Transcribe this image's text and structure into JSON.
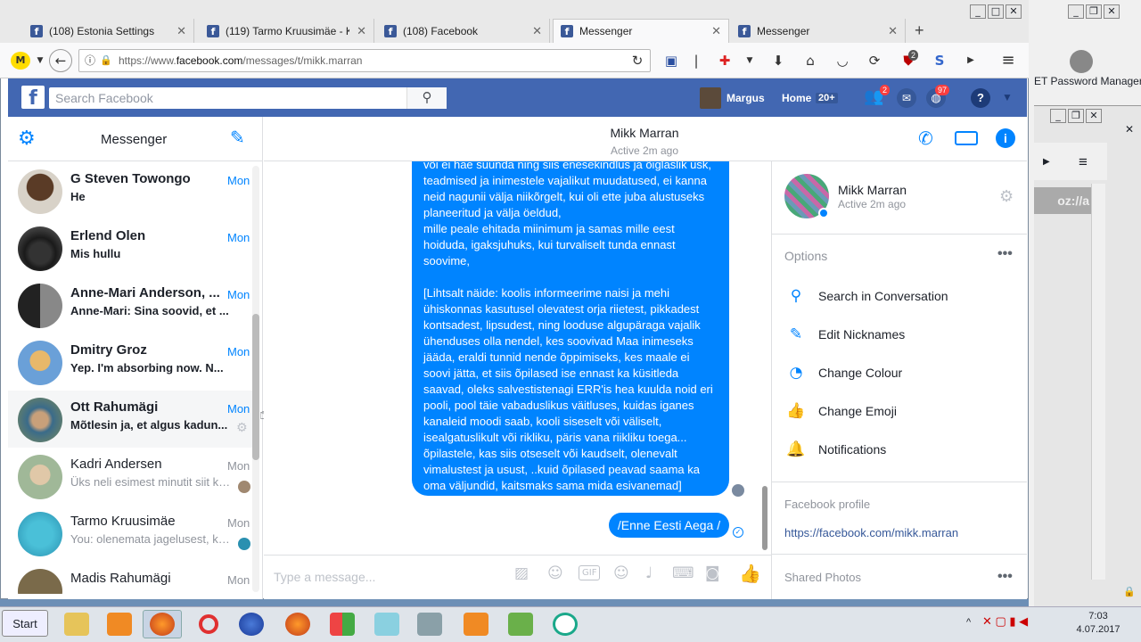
{
  "browser": {
    "tabs": [
      {
        "title": "(108) Estonia Settings"
      },
      {
        "title": "(119) Tarmo Kruusimäe - K"
      },
      {
        "title": "(108) Facebook"
      },
      {
        "title": "Messenger"
      },
      {
        "title": "Messenger"
      }
    ],
    "url_prefix": "https://www.",
    "url_domain": "facebook.com",
    "url_path": "/messages/t/mikk.marran",
    "ext_badge": "2"
  },
  "fb": {
    "search_placeholder": "Search Facebook",
    "user": "Margus",
    "home": "Home",
    "home_count": "20+",
    "friends_badge": "2",
    "notif_badge": "97"
  },
  "messenger": {
    "title": "Messenger",
    "conversations": [
      {
        "name": "G Steven Towongo",
        "snippet": "He",
        "time": "Mon",
        "unread": true
      },
      {
        "name": "Erlend Olen",
        "snippet": "Mis hullu",
        "time": "Mon",
        "unread": true
      },
      {
        "name": "Anne-Mari Anderson, ...",
        "snippet": "Anne-Mari: Sina soovid, et ...",
        "time": "Mon",
        "unread": true
      },
      {
        "name": "Dmitry Groz",
        "snippet": "Yep. I'm absorbing now. N...",
        "time": "Mon",
        "unread": true
      },
      {
        "name": "Ott Rahumägi",
        "snippet": "Mõtlesin ja, et algus kadun...",
        "time": "Mon",
        "unread": true
      },
      {
        "name": "Kadri Andersen",
        "snippet": "Üks neli esimest minutit siit ka...",
        "time": "Mon",
        "unread": false
      },
      {
        "name": "Tarmo Kruusimäe",
        "snippet": "You: olenemata jagelusest, ku...",
        "time": "Mon",
        "unread": false
      },
      {
        "name": "Madis Rahumägi",
        "snippet": "",
        "time": "Mon",
        "unread": false
      }
    ]
  },
  "chat": {
    "contact": "Mikk Marran",
    "status": "Active 2m ago",
    "message_text": "või ei hae suunda ning siis enesekindlus ja õiglaslik usk, teadmised ja inimestele vajalikut muudatused, ei kanna neid nagunii välja niikõrgelt, kui oli ette juba alustuseks planeeritud ja välja öeldud,\nmille peale ehitada miinimum ja samas mille eest hoiduda, igaksjuhuks, kui turvaliselt tunda ennast soovime,\n\n[Lihtsalt näide: koolis informeerime naisi ja mehi ühiskonnas kasutusel olevatest orja riietest, pikkadest kontsadest, lipsudest, ning looduse algupäraga vajalik ühenduses olla nendel, kes soovivad Maa inimeseks jääda, eraldi tunnid nende õppimiseks, kes maale ei soovi jätta, et siis õpilased ise ennast ka küsitleda saavad, oleks salvestistenagi ERR'is hea kuulda noid eri pooli, pool täie vabaduslikus väitluses, kuidas iganes kanaleid moodi saab, kooli siseselt või väliselt, isealgatuslikult või rikliku, päris vana riikliku toega... õpilastele, kas siis otseselt või kaudselt, olenevalt vimalustest ja usust, ..kuid õpilased peavad saama ka oma väljundid, kaitsmaks sama mida esivanemad]",
    "message2": "/Enne Eesti Aega /",
    "composer_placeholder": "Type a message..."
  },
  "info": {
    "name": "Mikk Marran",
    "status": "Active 2m ago",
    "options_title": "Options",
    "options": [
      {
        "label": "Search in Conversation",
        "icon": "search-icon"
      },
      {
        "label": "Edit Nicknames",
        "icon": "pencil-icon"
      },
      {
        "label": "Change Colour",
        "icon": "palette-icon"
      },
      {
        "label": "Change Emoji",
        "icon": "thumbs-up-icon"
      },
      {
        "label": "Notifications",
        "icon": "bell-icon"
      }
    ],
    "profile_title": "Facebook profile",
    "profile_link": "https://facebook.com/mikk.marran",
    "photos_title": "Shared Photos"
  },
  "side_app": {
    "title": "ET Password Manager",
    "url_fragment": "oz://a"
  },
  "taskbar": {
    "start": "Start",
    "time": "7:03",
    "date": "4.07.2017"
  }
}
